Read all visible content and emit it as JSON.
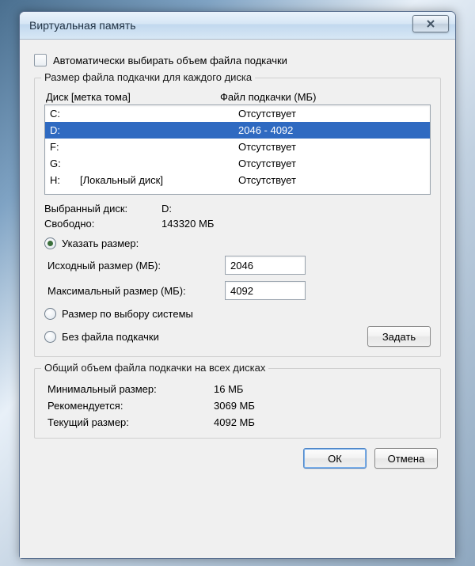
{
  "window": {
    "title": "Виртуальная память"
  },
  "auto": {
    "label": "Автоматически выбирать объем файла подкачки"
  },
  "perDrive": {
    "legend": "Размер файла подкачки для каждого диска",
    "colDrive": "Диск [метка тома]",
    "colFile": "Файл подкачки (МБ)",
    "drives": [
      {
        "letter": "C:",
        "label": "",
        "status": "Отсутствует",
        "selected": false
      },
      {
        "letter": "D:",
        "label": "",
        "status": "2046 - 4092",
        "selected": true
      },
      {
        "letter": "F:",
        "label": "",
        "status": "Отсутствует",
        "selected": false
      },
      {
        "letter": "G:",
        "label": "",
        "status": "Отсутствует",
        "selected": false
      },
      {
        "letter": "H:",
        "label": "[Локальный диск]",
        "status": "Отсутствует",
        "selected": false
      }
    ],
    "selectedDriveLabel": "Выбранный диск:",
    "selectedDriveValue": "D:",
    "freeLabel": "Свободно:",
    "freeValue": "143320 МБ",
    "optCustom": "Указать размер:",
    "initialLabel": "Исходный размер (МБ):",
    "initialValue": "2046",
    "maxLabel": "Максимальный размер (МБ):",
    "maxValue": "4092",
    "optSystem": "Размер по выбору системы",
    "optNone": "Без файла подкачки",
    "setButton": "Задать"
  },
  "totals": {
    "legend": "Общий объем файла подкачки на всех дисках",
    "minLabel": "Минимальный размер:",
    "minValue": "16 МБ",
    "recLabel": "Рекомендуется:",
    "recValue": "3069 МБ",
    "curLabel": "Текущий размер:",
    "curValue": "4092 МБ"
  },
  "buttons": {
    "ok": "ОК",
    "cancel": "Отмена"
  }
}
